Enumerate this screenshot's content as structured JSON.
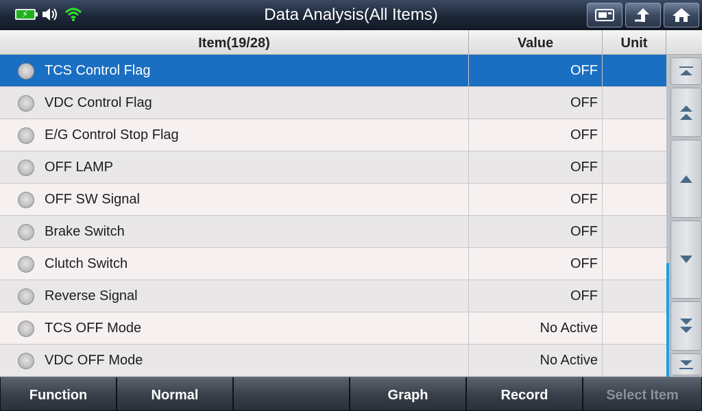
{
  "header": {
    "title": "Data Analysis(All Items)",
    "status_icons": [
      "battery-charging-icon",
      "speaker-icon",
      "wifi-icon"
    ],
    "buttons": [
      "screenshot-icon",
      "back-icon",
      "home-icon"
    ]
  },
  "table": {
    "headers": {
      "item": "Item(19/28)",
      "value": "Value",
      "unit": "Unit"
    },
    "rows": [
      {
        "label": "TCS Control Flag",
        "value": "OFF",
        "unit": "",
        "selected": true
      },
      {
        "label": "VDC Control Flag",
        "value": "OFF",
        "unit": ""
      },
      {
        "label": "E/G Control Stop Flag",
        "value": "OFF",
        "unit": ""
      },
      {
        "label": "OFF LAMP",
        "value": "OFF",
        "unit": ""
      },
      {
        "label": "OFF SW Signal",
        "value": "OFF",
        "unit": ""
      },
      {
        "label": "Brake Switch",
        "value": "OFF",
        "unit": ""
      },
      {
        "label": "Clutch Switch",
        "value": "OFF",
        "unit": ""
      },
      {
        "label": "Reverse Signal",
        "value": "OFF",
        "unit": ""
      },
      {
        "label": "TCS OFF Mode",
        "value": "No Active",
        "unit": ""
      },
      {
        "label": "VDC OFF Mode",
        "value": "No Active",
        "unit": ""
      }
    ]
  },
  "scrollbar": {
    "buttons": [
      "scroll-top-icon",
      "page-up-icon",
      "line-up-icon",
      "line-down-icon",
      "page-down-icon",
      "scroll-bottom-icon"
    ],
    "position": 0.82
  },
  "footer": {
    "function": "Function",
    "normal": "Normal",
    "empty": "",
    "graph": "Graph",
    "record": "Record",
    "select_item": "Select Item"
  },
  "colors": {
    "selected_row": "#1a6fc2",
    "title_bar": "#1d2738",
    "scroll_accent": "#1ea0e0"
  }
}
